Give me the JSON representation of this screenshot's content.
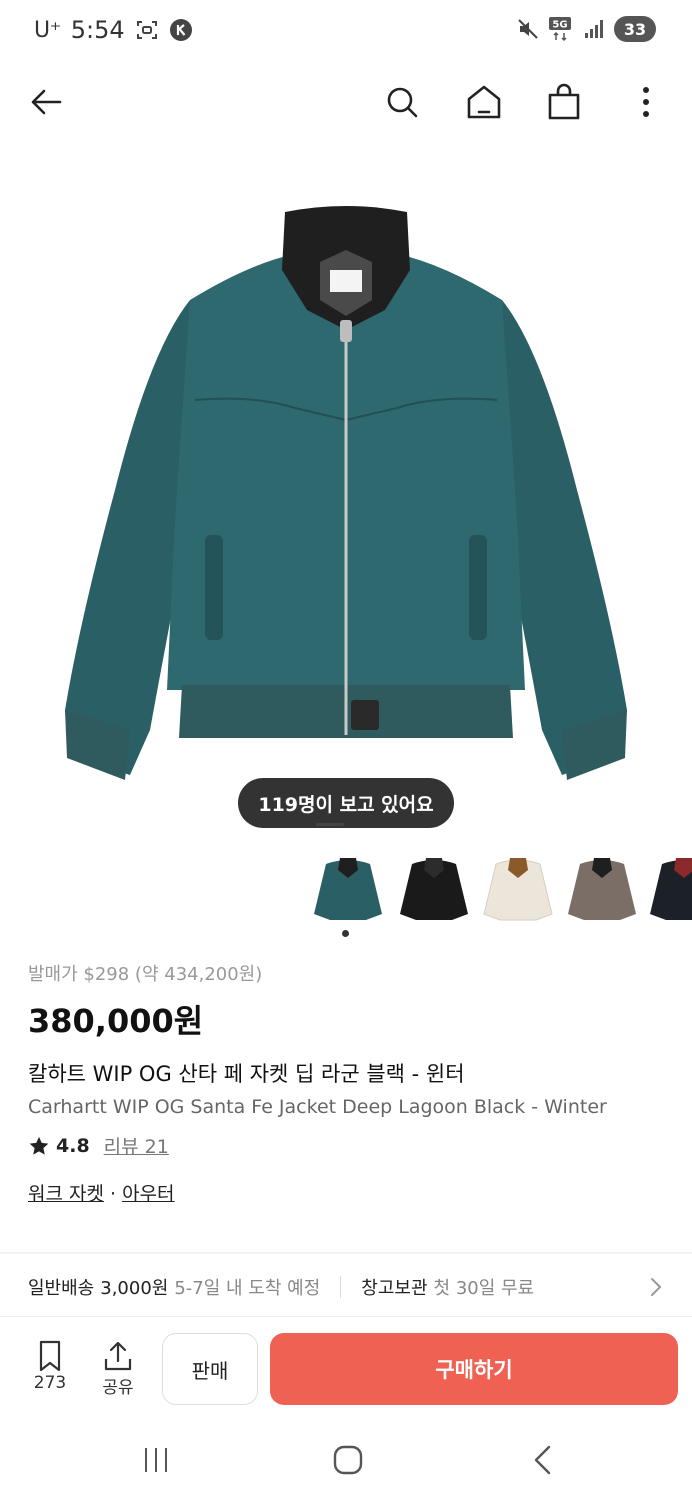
{
  "status_bar": {
    "carrier": "U⁺",
    "time": "5:54",
    "network": "5G",
    "battery": "33"
  },
  "nav": {
    "icons": [
      "back-arrow-icon",
      "search-icon",
      "home-icon",
      "shopping-bag-icon",
      "more-vertical-icon"
    ]
  },
  "product": {
    "viewers": "119명이 보고 있어요",
    "release_price": "발매가 $298 (약 434,200원)",
    "price": "380,000원",
    "name_ko": "칼하트 WIP OG 산타 페 자켓 딥 라군 블랙 - 윈터",
    "name_en": "Carhartt WIP OG Santa Fe Jacket Deep Lagoon Black - Winter",
    "rating": "4.8",
    "reviews": "리뷰 21",
    "category_1": "워크 자켓",
    "category_sep": " · ",
    "category_2": "아우터",
    "colors": {
      "teal": "#2b5f66",
      "collar": "#1f1f1f",
      "ivory": "#ece6da",
      "taupe": "#7a6e66"
    }
  },
  "shipping": {
    "label": "일반배송",
    "fee": "3,000원",
    "eta": "5-7일 내 도착 예정",
    "storage_label": "창고보관",
    "storage_info": "첫 30일 무료"
  },
  "bottom": {
    "bookmark_count": "273",
    "share_label": "공유",
    "sell_label": "판매",
    "buy_label": "구매하기",
    "buy_color": "#ef6253"
  }
}
